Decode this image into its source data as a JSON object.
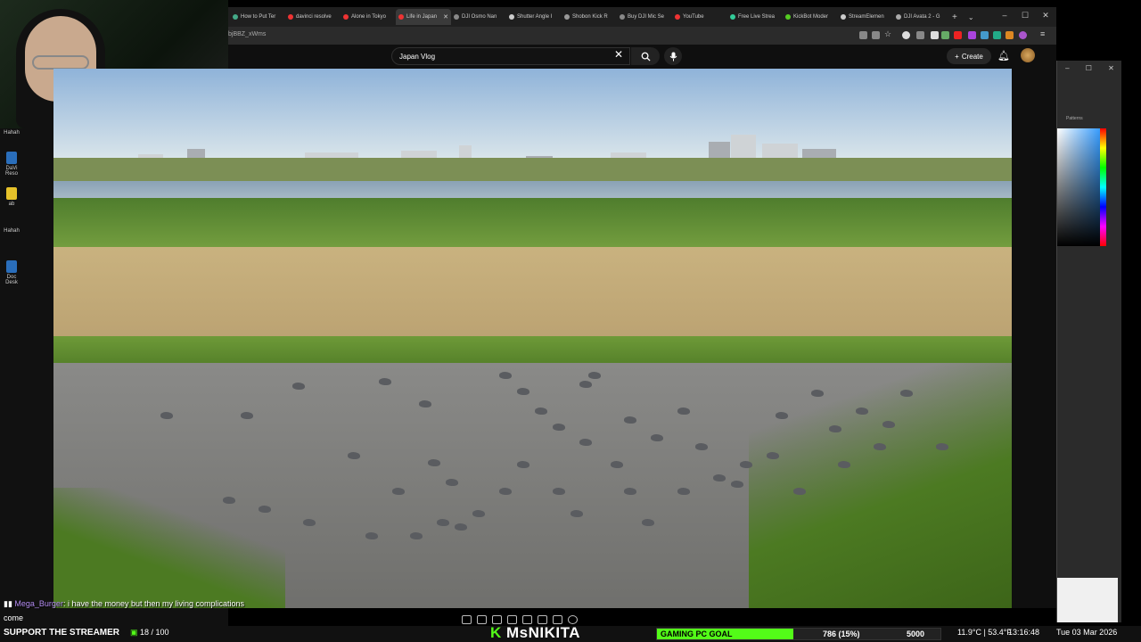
{
  "browser": {
    "tabs": [
      {
        "label": "How to Put Ter",
        "active": false
      },
      {
        "label": "davinci resolve",
        "active": false
      },
      {
        "label": "Alone in Tokyo",
        "active": false
      },
      {
        "label": "Life in Japan",
        "active": true
      },
      {
        "label": "DJI Osmo Nan",
        "active": false
      },
      {
        "label": "Shutter Angle I",
        "active": false
      },
      {
        "label": "Shobon Kick R",
        "active": false
      },
      {
        "label": "Buy DJI Mic Se",
        "active": false
      },
      {
        "label": "YouTube",
        "active": false
      },
      {
        "label": "Free Live Strea",
        "active": false
      },
      {
        "label": "KickBot Moder",
        "active": false
      },
      {
        "label": "StreamElemen",
        "active": false
      },
      {
        "label": "DJI Avata 2 - G",
        "active": false
      }
    ],
    "new_tab_label": "+",
    "url_fragment": "bjBBZ_xWms"
  },
  "youtube": {
    "search_value": "Japan Vlog",
    "create_label": "Create"
  },
  "chat": {
    "username": "Mega_Burger",
    "message": ": i have the money but then my living complications",
    "message_cont": "come"
  },
  "stream": {
    "support_text": "SUPPORT THE STREAMER",
    "kick_count": "18",
    "kick_total": "100",
    "brand_k": "K",
    "brand_name": "MsNIKITA",
    "goal_label": "GAMING PC GOAL",
    "goal_progress": "786 (15%)",
    "goal_percent": 15,
    "goal_target": "5000",
    "weather": "11.9°C | 53.4°F",
    "clock": "13:16:48",
    "date": "Tue 03 Mar 2026"
  },
  "desktop": {
    "icons": [
      "Hahah",
      "DaVi Reso",
      "ab",
      "Hahah",
      "Doc Desk"
    ]
  },
  "photoshop": {
    "panel_label": "Patterns"
  },
  "colors": {
    "kick_green": "#53fc18",
    "chat_user": "#b48cf2"
  }
}
